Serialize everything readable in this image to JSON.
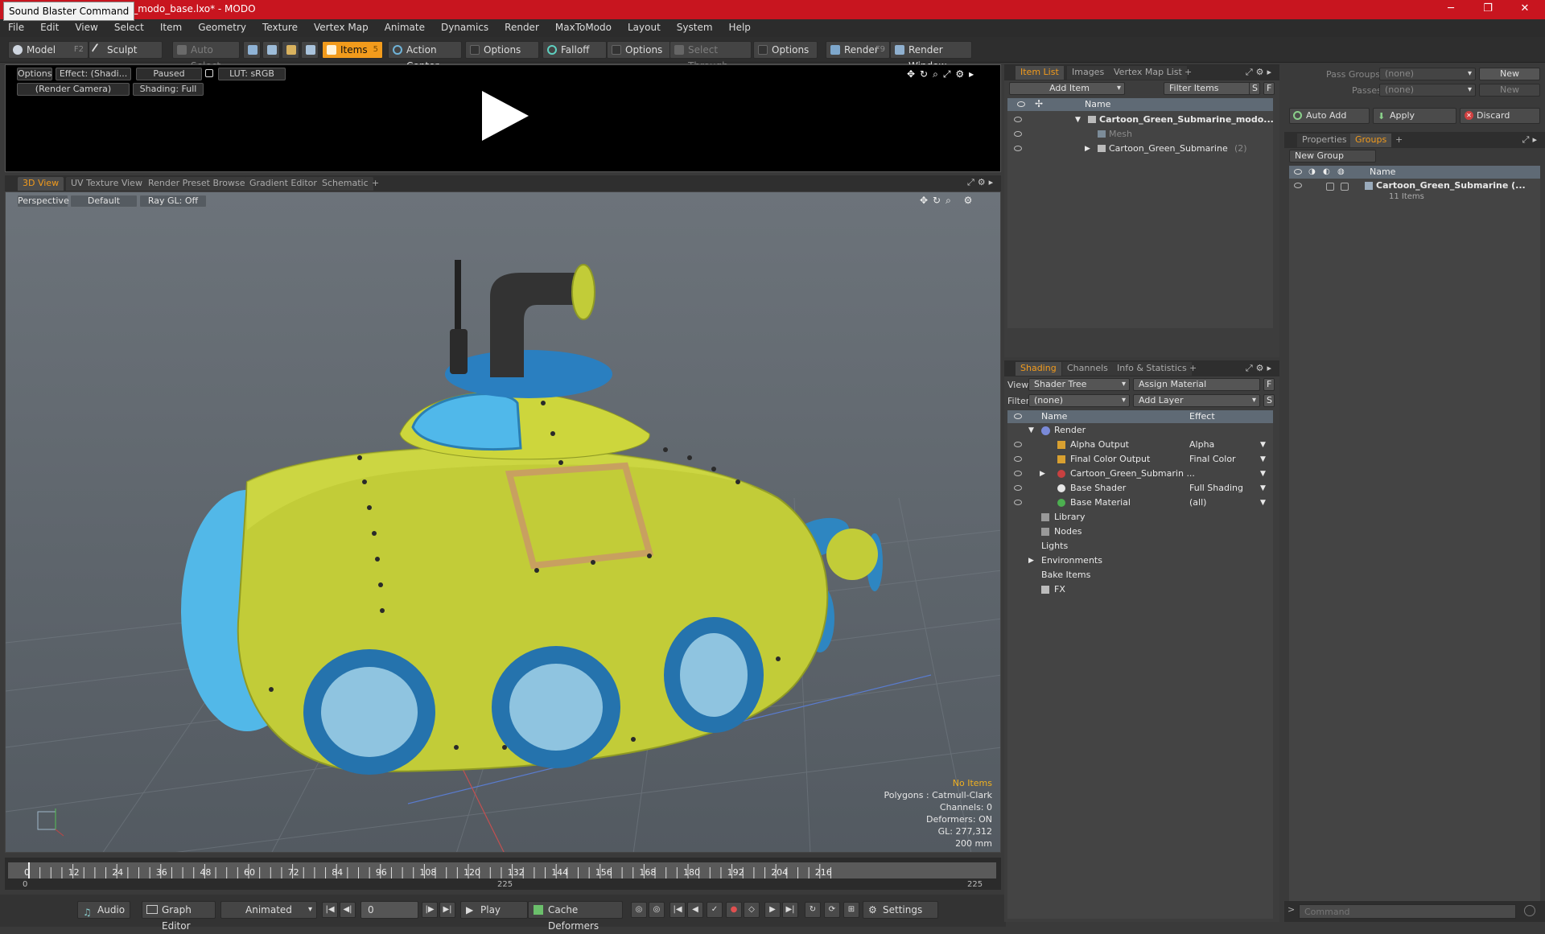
{
  "title": {
    "tooltip": "Sound Blaster Command",
    "document": "rine_modo_base.lxo* - MODO",
    "min": "─",
    "max": "❐",
    "close": "✕"
  },
  "menu": [
    "File",
    "Edit",
    "View",
    "Select",
    "Item",
    "Geometry",
    "Texture",
    "Vertex Map",
    "Animate",
    "Dynamics",
    "Render",
    "MaxToModo",
    "Layout",
    "System",
    "Help"
  ],
  "toolbar": {
    "model": "Model",
    "model_key": "F2",
    "sculpt": "Sculpt",
    "auto_select": "Auto Select",
    "items": "Items",
    "items_key": "5",
    "action_center": "Action Center",
    "options1": "Options",
    "falloff": "Falloff",
    "options2": "Options",
    "select_through": "Select Through",
    "options3": "Options",
    "render": "Render",
    "render_key": "F9",
    "render_window": "Render Window"
  },
  "preview": {
    "options": "Options",
    "effect": "Effect: (Shadi...",
    "paused": "Paused",
    "lut": "LUT: sRGB",
    "camera": "(Render Camera)",
    "shading": "Shading: Full"
  },
  "viewtabs": [
    "3D View",
    "UV Texture View",
    "Render Preset Browser",
    "Gradient Editor",
    "Schematic",
    "+"
  ],
  "hud": {
    "perspective": "Perspective",
    "default": "Default",
    "raygl": "Ray GL: Off"
  },
  "stats": {
    "no_items": "No Items",
    "polygons": "Polygons : Catmull-Clark",
    "channels": "Channels: 0",
    "deformers": "Deformers: ON",
    "gl": "GL: 277,312",
    "size": "200 mm"
  },
  "timeline": {
    "ticks": [
      "0",
      "12",
      "24",
      "36",
      "48",
      "60",
      "72",
      "84",
      "96",
      "108",
      "120",
      "132",
      "144",
      "156",
      "168",
      "180",
      "192",
      "204",
      "216"
    ],
    "start": "0",
    "mid": "225",
    "end": "225"
  },
  "transport": {
    "audio": "Audio",
    "graph": "Graph Editor",
    "animated": "Animated",
    "frame": "0",
    "play": "Play",
    "cache": "Cache Deformers",
    "settings": "Settings"
  },
  "itemlist": {
    "tabs": [
      "Item List",
      "Images",
      "Vertex Map List",
      "+"
    ],
    "add_item": "Add Item",
    "filter": "Filter Items",
    "s": "S",
    "f": "F",
    "col_name": "Name",
    "rows": [
      {
        "label": "Cartoon_Green_Submarine_modo...",
        "bold": true
      },
      {
        "label": "Mesh",
        "bold": false
      },
      {
        "label": "Cartoon_Green_Submarine",
        "suffix": "(2)",
        "bold": false
      }
    ]
  },
  "shading": {
    "tabs": [
      "Shading",
      "Channels",
      "Info & Statistics",
      "+"
    ],
    "view_label": "View",
    "view_value": "Shader Tree",
    "assign": "Assign Material",
    "f": "F",
    "filter_label": "Filter",
    "filter_value": "(none)",
    "add_layer": "Add Layer",
    "s": "S",
    "col_name": "Name",
    "col_effect": "Effect",
    "rows": [
      {
        "label": "Render",
        "effect": ""
      },
      {
        "label": "Alpha Output",
        "effect": "Alpha"
      },
      {
        "label": "Final Color Output",
        "effect": "Final Color"
      },
      {
        "label": "Cartoon_Green_Submarin ...",
        "effect": ""
      },
      {
        "label": "Base Shader",
        "effect": "Full Shading"
      },
      {
        "label": "Base Material",
        "effect": "(all)"
      },
      {
        "label": "Library",
        "effect": ""
      },
      {
        "label": "Nodes",
        "effect": ""
      },
      {
        "label": "Lights",
        "effect": ""
      },
      {
        "label": "Environments",
        "effect": ""
      },
      {
        "label": "Bake Items",
        "effect": ""
      },
      {
        "label": "FX",
        "effect": ""
      }
    ]
  },
  "groups": {
    "pass_groups": "Pass Groups",
    "pass_groups_value": "(none)",
    "new": "New",
    "passes": "Passes",
    "passes_value": "(none)",
    "new2": "New",
    "auto_add": "Auto Add",
    "apply": "Apply",
    "discard": "Discard",
    "tabs": [
      "Properties",
      "Groups",
      "+"
    ],
    "new_group": "New Group",
    "col_name": "Name",
    "group_name": "Cartoon_Green_Submarine (...",
    "group_count": "11 Items"
  },
  "command": {
    "placeholder": "Command"
  },
  "colors": {
    "accent": "#f29b1c",
    "titlebar": "#c8151f",
    "hull": "#c2cc38",
    "blue": "#3a9bd4"
  }
}
